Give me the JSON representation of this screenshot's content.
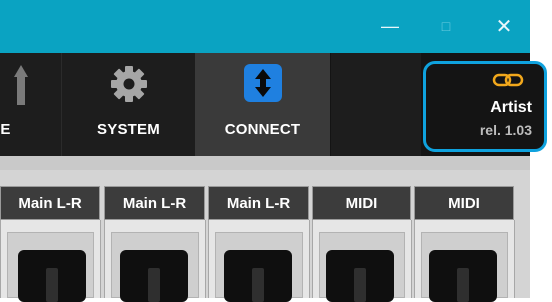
{
  "window": {
    "minimize_glyph": "—",
    "maximize_glyph": "□",
    "close_glyph": "✕",
    "titlebar_color": "#0aa3c2"
  },
  "toolbar": {
    "tabs": [
      {
        "label": "RE",
        "icon": "arrow-up-icon"
      },
      {
        "label": "SYSTEM",
        "icon": "gear-icon"
      },
      {
        "label": "CONNECT",
        "icon": "up-down-arrows-icon",
        "selected": true
      }
    ]
  },
  "artist": {
    "name": "Artist",
    "release": "rel. 1.03",
    "icon": "chain-link-icon",
    "highlight_color": "#0fa2de",
    "logo_color": "#f2a81c"
  },
  "channels": [
    {
      "label": "Main L-R"
    },
    {
      "label": "Main L-R"
    },
    {
      "label": "Main L-R"
    },
    {
      "label": "MIDI"
    },
    {
      "label": "MIDI"
    }
  ]
}
